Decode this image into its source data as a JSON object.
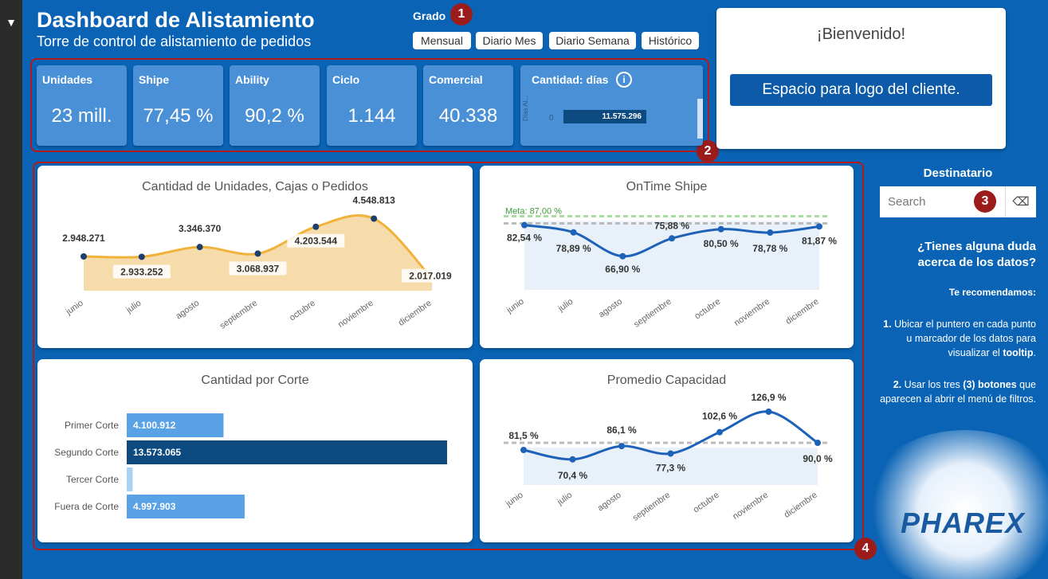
{
  "header": {
    "title": "Dashboard de Alistamiento",
    "subtitle": "Torre de control de alistamiento de pedidos"
  },
  "granularity": {
    "label": "Grado",
    "buttons": [
      "Mensual",
      "Diario Mes",
      "Diario Semana",
      "Histórico"
    ]
  },
  "markers": [
    "1",
    "2",
    "3",
    "4"
  ],
  "kpis": [
    {
      "label": "Unidades",
      "value": "23 mill."
    },
    {
      "label": "Shipe",
      "value": "77,45 %"
    },
    {
      "label": "Ability",
      "value": "90,2 %"
    },
    {
      "label": "Ciclo",
      "value": "1.144"
    },
    {
      "label": "Comercial",
      "value": "40.338"
    }
  ],
  "days_card": {
    "label": "Cantidad: días",
    "axis_label": "Días Al...",
    "category": "0",
    "value": "11.575.296"
  },
  "welcome": {
    "title": "¡Bienvenido!",
    "logo_placeholder": "Espacio para logo del cliente."
  },
  "sidebar": {
    "dest_label": "Destinatario",
    "search_placeholder": "Search",
    "faq": "¿Tienes alguna duda acerca de los datos?",
    "recommend": "Te recomendamos:",
    "tip1_num": "1.",
    "tip1": "Ubicar el puntero en cada punto u marcador de los datos para visualizar el",
    "tip1_bold": "tooltip",
    "tip2_num": "2.",
    "tip2_a": "Usar los tres",
    "tip2_b": "(3) botones",
    "tip2_c": "que aparecen al abrir el menú de filtros.",
    "brand": "PHAREX"
  },
  "colors": {
    "background": "#0a63b4",
    "kpi": "#4a90d6",
    "area_orange": "#f6dcaa",
    "line_orange": "#f0b23a",
    "line_blue": "#1d62b8",
    "bar_light": "#5aa2e6",
    "bar_dark": "#0d4a80",
    "marker_red": "#9c1c1c"
  },
  "chart_data": [
    {
      "type": "area",
      "title": "Cantidad de Unidades, Cajas o Pedidos",
      "categories": [
        "junio",
        "julio",
        "agosto",
        "septiembre",
        "octubre",
        "noviembre",
        "diciembre"
      ],
      "values": [
        2948271,
        2933252,
        3346370,
        3068937,
        4203544,
        4548813,
        2017019
      ],
      "labels": [
        "2.948.271",
        "2.933.252",
        "3.346.370",
        "3.068.937",
        "4.203.544",
        "4.548.813",
        "2.017.019"
      ]
    },
    {
      "type": "line",
      "title": "OnTime Shipe",
      "categories": [
        "junio",
        "julio",
        "agosto",
        "septiembre",
        "octubre",
        "noviembre",
        "diciembre"
      ],
      "values": [
        82.54,
        78.89,
        66.9,
        75.88,
        80.5,
        78.78,
        81.87
      ],
      "labels": [
        "82,54 %",
        "78,89 %",
        "66,90 %",
        "75,88 %",
        "80,50 %",
        "78,78 %",
        "81,87 %"
      ],
      "target_label": "Meta: 87,00 %",
      "target": 87.0
    },
    {
      "type": "bar",
      "title": "Cantidad por Corte",
      "categories": [
        "Primer Corte",
        "Segundo Corte",
        "Tercer Corte",
        "Fuera de Corte"
      ],
      "values": [
        4100912,
        13573065,
        250000,
        4997903
      ],
      "labels": [
        "4.100.912",
        "13.573.065",
        "",
        "4.997.903"
      ]
    },
    {
      "type": "line",
      "title": "Promedio Capacidad",
      "categories": [
        "junio",
        "julio",
        "agosto",
        "septiembre",
        "octubre",
        "noviembre",
        "diciembre"
      ],
      "values": [
        81.5,
        70.4,
        86.1,
        77.3,
        102.6,
        126.9,
        90.0
      ],
      "labels": [
        "81,5 %",
        "70,4 %",
        "86,1 %",
        "77,3 %",
        "102,6 %",
        "126,9 %",
        "90,0 %"
      ]
    }
  ]
}
